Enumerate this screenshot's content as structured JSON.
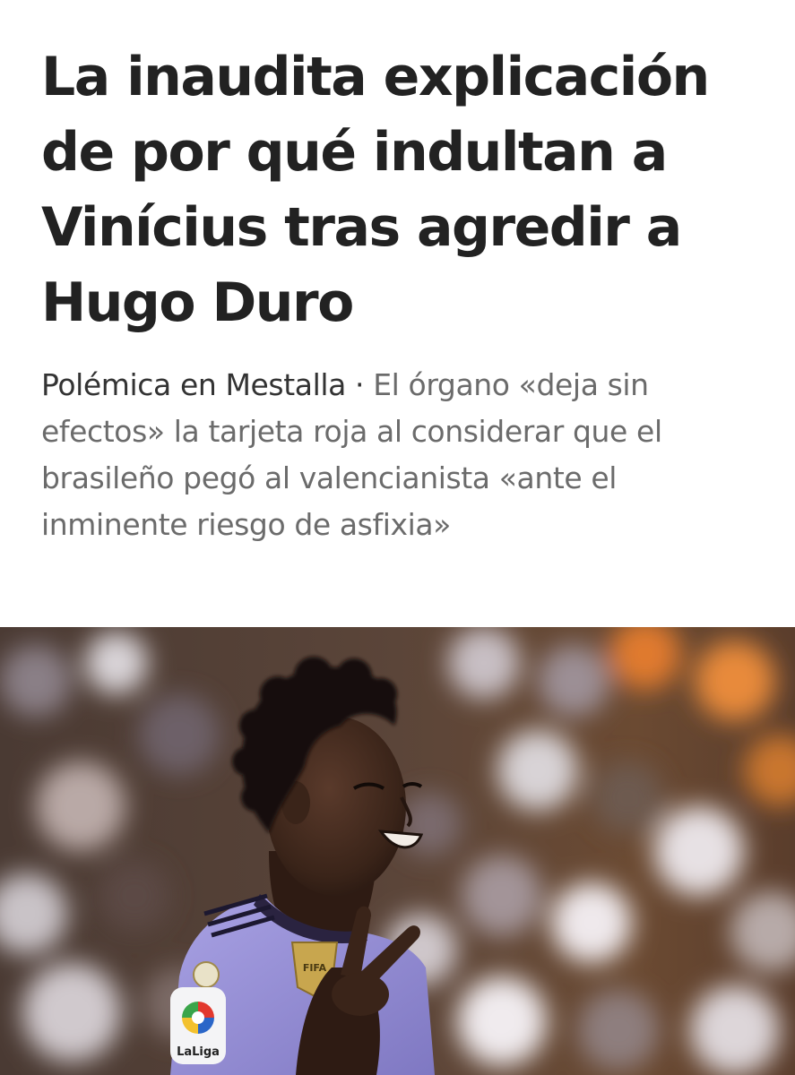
{
  "article": {
    "headline": "La inaudita explicación de por qué indultan a Vinícius tras agredir a Hugo Duro",
    "kicker": "Polémica en Mestalla",
    "separator": " · ",
    "summary": "El órgano «deja sin efectos» la tarjeta roja al considerar que el brasileño pegó al valencianista «ante el inminente riesgo de asfixia»",
    "photo": {
      "badge_text": "LaLiga",
      "fifa_text": "FIFA"
    }
  },
  "colors": {
    "headline": "#222222",
    "summary": "#6b6b6b",
    "kicker": "#333333",
    "kit": "#9a93d8"
  }
}
